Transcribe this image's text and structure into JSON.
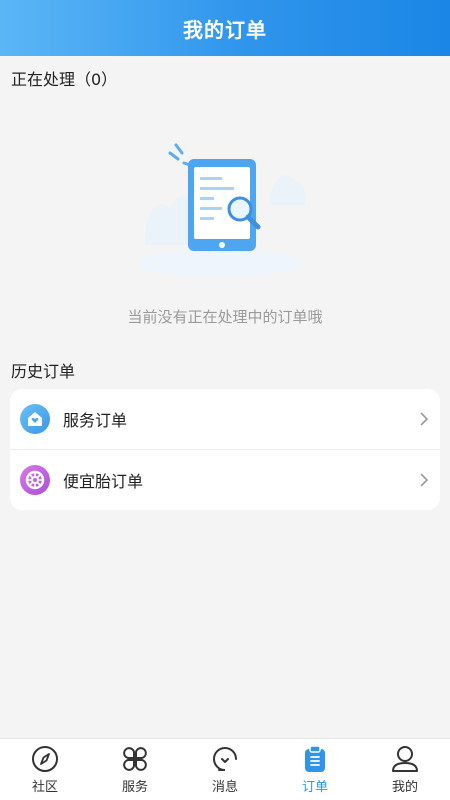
{
  "header": {
    "title": "我的订单"
  },
  "processing": {
    "label": "正在处理（0）",
    "empty_text": "当前没有正在处理中的订单哦"
  },
  "history": {
    "label": "历史订单",
    "items": [
      {
        "label": "服务订单",
        "icon": "house-heart-icon",
        "color": "#4aa8ee"
      },
      {
        "label": "便宜胎订单",
        "icon": "tire-icon",
        "color": "#c163e0"
      }
    ]
  },
  "tabbar": {
    "active_color": "#2f95ec",
    "tabs": [
      {
        "label": "社区",
        "icon": "compass-icon"
      },
      {
        "label": "服务",
        "icon": "grid-icon"
      },
      {
        "label": "消息",
        "icon": "chat-icon"
      },
      {
        "label": "订单",
        "icon": "clipboard-icon",
        "active": true
      },
      {
        "label": "我的",
        "icon": "user-icon"
      }
    ]
  }
}
